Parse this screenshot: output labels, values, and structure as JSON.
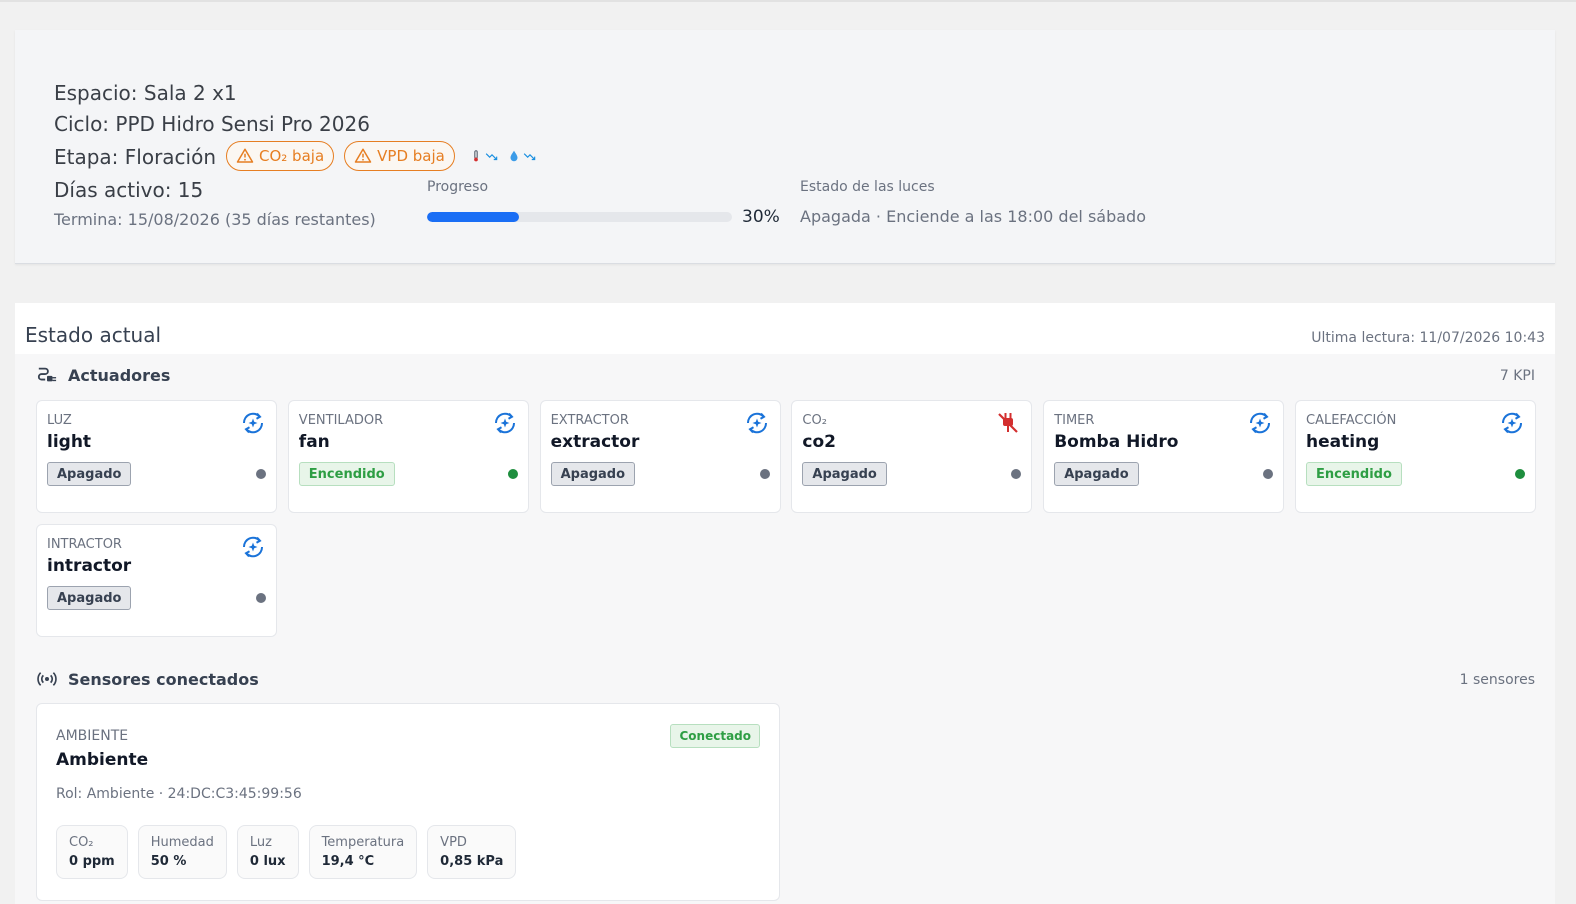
{
  "summary": {
    "space": "Espacio: Sala 2 x1",
    "cycle": "Ciclo: PPD Hidro Sensi Pro 2026",
    "stage": "Etapa: Floración",
    "days_active": "Días activo: 15",
    "ends": "Termina: 15/08/2026 (35 días restantes)",
    "alerts": [
      {
        "label": "CO₂ baja",
        "icon": "warning-icon"
      },
      {
        "label": "VPD baja",
        "icon": "warning-icon"
      }
    ],
    "trend_icons": [
      "thermometer-icon",
      "trend-down-icon",
      "droplet-icon",
      "trend-down-icon"
    ],
    "progress_label": "Progreso",
    "progress_value": 30,
    "progress_text": "30%",
    "lights_label": "Estado de las luces",
    "lights_value": "Apagada · Enciende a las 18:00 del sábado"
  },
  "estado": {
    "title": "Estado actual",
    "last_reading": "Ultima lectura: 11/07/2026 10:43",
    "actuators_title": "Actuadores",
    "actuators_count": "7 KPI",
    "actuators": [
      {
        "type": "Luz",
        "name": "light",
        "state": "Apagado",
        "on": false,
        "icon": "auto-mode-icon"
      },
      {
        "type": "Ventilador",
        "name": "fan",
        "state": "Encendido",
        "on": true,
        "icon": "auto-mode-icon"
      },
      {
        "type": "Extractor",
        "name": "extractor",
        "state": "Apagado",
        "on": false,
        "icon": "auto-mode-icon"
      },
      {
        "type": "CO₂",
        "name": "co2",
        "state": "Apagado",
        "on": false,
        "icon": "plug-off-icon"
      },
      {
        "type": "Timer",
        "name": "Bomba Hidro",
        "state": "Apagado",
        "on": false,
        "icon": "auto-mode-icon"
      },
      {
        "type": "Calefacción",
        "name": "heating",
        "state": "Encendido",
        "on": true,
        "icon": "auto-mode-icon"
      },
      {
        "type": "Intractor",
        "name": "intractor",
        "state": "Apagado",
        "on": false,
        "icon": "auto-mode-icon"
      }
    ],
    "sensors_title": "Sensores conectados",
    "sensors_count": "1 sensores",
    "sensor": {
      "type": "AMBIENTE",
      "name": "Ambiente",
      "status": "Conectado",
      "meta": "Rol: Ambiente · 24:DC:C3:45:99:56",
      "metrics": [
        {
          "label": "CO₂",
          "value": "0 ppm"
        },
        {
          "label": "Humedad",
          "value": "50 %"
        },
        {
          "label": "Luz",
          "value": "0 lux"
        },
        {
          "label": "Temperatura",
          "value": "19,4 °C"
        },
        {
          "label": "VPD",
          "value": "0,85 kPa"
        }
      ]
    }
  },
  "colors": {
    "accent": "#1a6ef5",
    "warning": "#e67e22",
    "on": "#1e8e3e",
    "off": "#6b7280",
    "danger": "#d32f2f"
  }
}
